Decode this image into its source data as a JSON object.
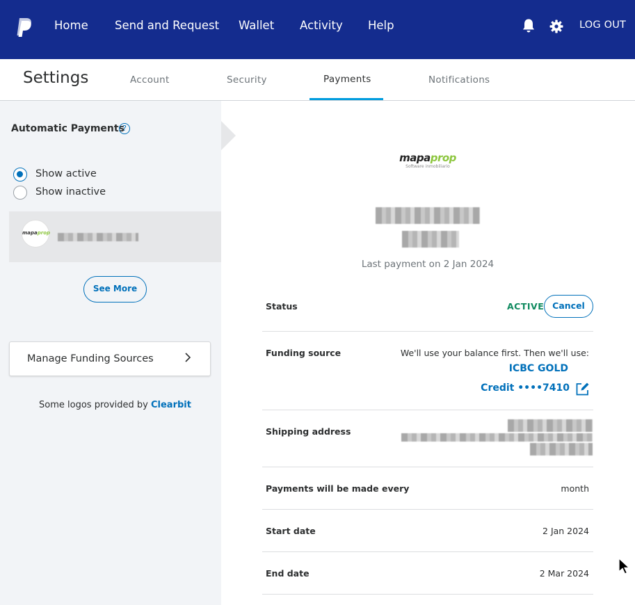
{
  "topnav": {
    "items": [
      "Home",
      "Send and Request",
      "Wallet",
      "Activity",
      "Help"
    ],
    "logout": "LOG OUT",
    "icons": [
      "paypal-logo",
      "bell-icon",
      "gear-icon"
    ]
  },
  "settings": {
    "title": "Settings",
    "tabs": [
      "Account",
      "Security",
      "Payments",
      "Notifications"
    ],
    "active_tab": "Payments"
  },
  "left_panel": {
    "title": "Automatic Payments",
    "filters": [
      {
        "label": "Show active",
        "checked": true
      },
      {
        "label": "Show inactive",
        "checked": false
      }
    ],
    "merchant_logo_text": "mapaprop",
    "see_more": "See More",
    "manage_funding": "Manage Funding Sources",
    "logos_note": "Some logos provided by",
    "logos_link": "Clearbit"
  },
  "detail": {
    "brand_logo": "mapaprop",
    "brand_sub": "Software inmobiliario",
    "last_payment": "Last payment on 2 Jan 2024",
    "status_label": "Status",
    "status_value": "ACTIVE",
    "cancel": "Cancel",
    "funding_label": "Funding source",
    "funding_note": "We'll use your balance first. Then we'll use:",
    "funding_bank": "ICBC GOLD",
    "funding_card": "Credit ••••7410",
    "shipping_label": "Shipping address",
    "frequency_label": "Payments will be made every",
    "frequency_value": "month",
    "start_label": "Start date",
    "start_value": "2 Jan 2024",
    "end_label": "End date",
    "end_value": "2 Mar 2024"
  },
  "colors": {
    "nav_bg": "#142c8e",
    "link_blue": "#0070ba",
    "tab_accent": "#009cde",
    "active_green": "#0f8a5f",
    "panel_bg": "#f2f4f7"
  }
}
